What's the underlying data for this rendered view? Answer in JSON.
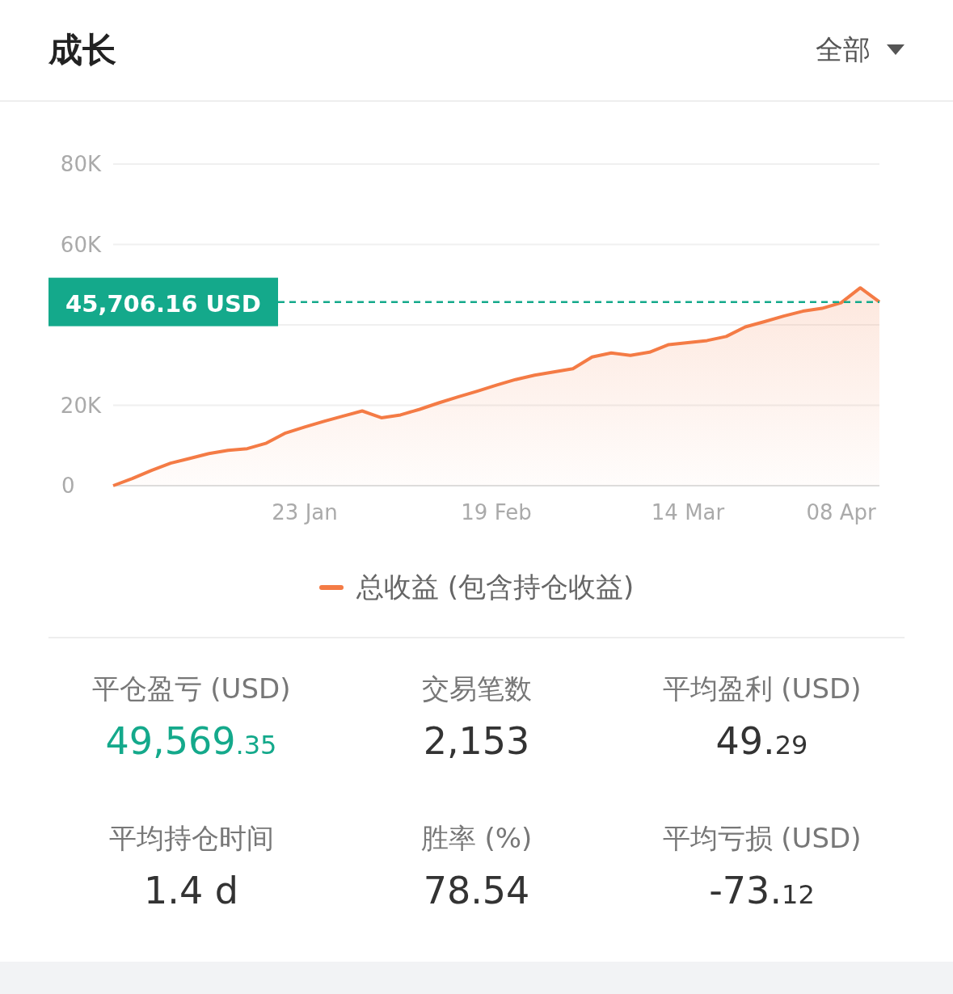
{
  "header": {
    "title": "成长",
    "filter": "全部"
  },
  "chart": {
    "badge": "45,706.16 USD",
    "chart_data": {
      "type": "area",
      "ylim": [
        0,
        80000
      ],
      "yticks": [
        {
          "value": 0,
          "label": "0"
        },
        {
          "value": 20000,
          "label": "20K"
        },
        {
          "value": 60000,
          "label": "60K"
        },
        {
          "value": 80000,
          "label": "80K"
        }
      ],
      "categories": [
        null,
        null,
        null,
        null,
        null,
        null,
        null,
        null,
        null,
        null,
        "23 Jan",
        null,
        null,
        null,
        null,
        null,
        null,
        null,
        null,
        null,
        "19 Feb",
        null,
        null,
        null,
        null,
        null,
        null,
        null,
        null,
        null,
        "14 Mar",
        null,
        null,
        null,
        null,
        null,
        null,
        null,
        "08 Apr",
        null,
        null
      ],
      "series": [
        {
          "name": "总收益 (包含持仓收益)",
          "color": "#f47b45",
          "values": [
            0,
            1770,
            3800,
            5600,
            6800,
            8000,
            8800,
            9200,
            10600,
            13100,
            14600,
            16000,
            17300,
            18600,
            16900,
            17600,
            19000,
            20600,
            22100,
            23500,
            25000,
            26400,
            27500,
            28300,
            29100,
            32000,
            33000,
            32400,
            33200,
            35100,
            35600,
            36100,
            37100,
            39500,
            40800,
            42200,
            43400,
            44100,
            45500,
            49200,
            45700
          ]
        }
      ]
    }
  },
  "stats": [
    {
      "label": "平仓盈亏 (USD)",
      "int": "49,569",
      "dec": ".35",
      "color": "#14a98b"
    },
    {
      "label": "交易笔数",
      "int": "2,153",
      "color": "#333333"
    },
    {
      "label": "平均盈利 (USD)",
      "int": "49.",
      "dec": "29",
      "color": "#333333"
    },
    {
      "label": "平均持仓时间",
      "int": "1.4 d",
      "color": "#333333"
    },
    {
      "label": "胜率 (%)",
      "int": "78.54",
      "color": "#333333"
    },
    {
      "label": "平均亏损 (USD)",
      "int": "-73.",
      "dec": "12",
      "color": "#333333"
    }
  ]
}
